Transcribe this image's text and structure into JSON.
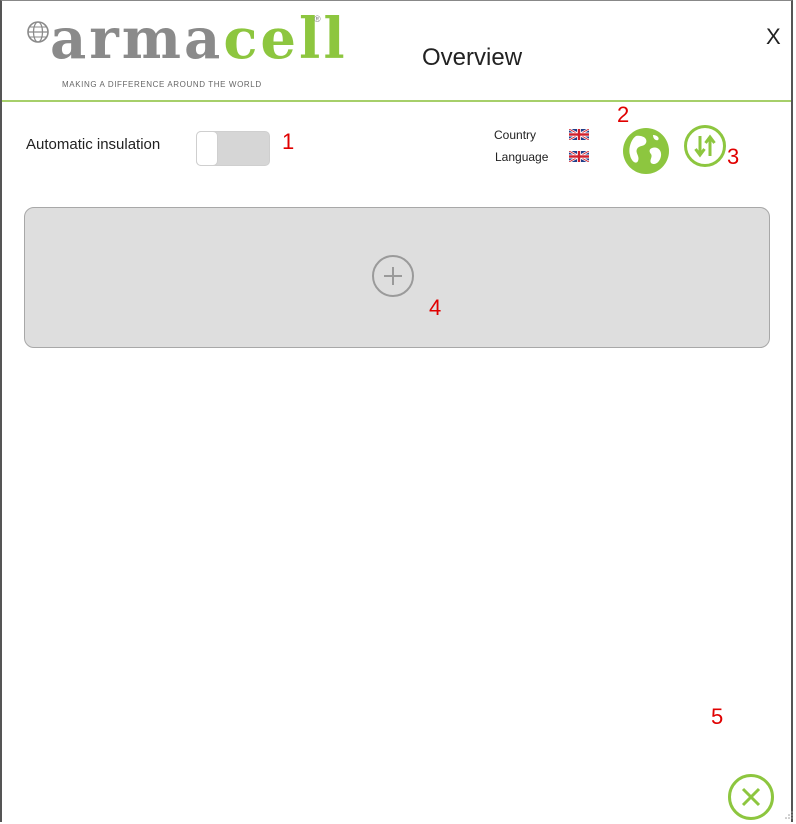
{
  "app": {
    "brand": {
      "name_part1": "arma",
      "name_part2": "cell",
      "registered": "®",
      "tagline": "MAKING A DIFFERENCE AROUND THE WORLD"
    },
    "title": "Overview",
    "close_label": "X"
  },
  "settings": {
    "automatic_insulation_label": "Automatic insulation",
    "automatic_insulation_on": false,
    "country_label": "Country",
    "language_label": "Language",
    "country_flag": "uk-flag-icon",
    "language_flag": "uk-flag-icon"
  },
  "icons": {
    "globe": "globe-icon",
    "sort": "sort-icon",
    "add": "plus-circle-icon",
    "close": "close-circle-icon"
  },
  "annotations": [
    "1",
    "2",
    "3",
    "4",
    "5"
  ],
  "colors": {
    "brand_green": "#8dc63f",
    "brand_gray": "#8a8a8a",
    "annotation_red": "#e00000",
    "panel_gray": "#dedede"
  }
}
